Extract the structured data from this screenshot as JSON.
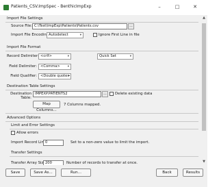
{
  "window": {
    "title": "Patients_CSV.ImpSpec - BenthicImpExp",
    "minimize": "–",
    "maximize": "□",
    "close": "✕"
  },
  "import_file_settings": {
    "title": "Import File Settings",
    "source_label": "Source File:",
    "source_value": "C:\\Test\\ImpExp\\Patients\\Patients.csv",
    "browse_label": "...",
    "encoding_label": "Import File Encoding:",
    "encoding_value": "Autodetect",
    "ignore_first_label": "Ignore First Line in file"
  },
  "import_file_format": {
    "title": "Import File Format",
    "record_label": "Record Delimiter:",
    "record_value": "<crlf>",
    "quick_set_value": "Quick Set",
    "field_label": "Field Delimiter:",
    "field_value": "<Comma>",
    "qualifier_label": "Field Qualifier:",
    "qualifier_value": "<Double quote>"
  },
  "destination_table_settings": {
    "title": "Destination Table Settings",
    "dest_label_1": "Destination",
    "dest_label_2": "Table:",
    "dest_value": "IMPEXP.PATIENTS2",
    "delete_label": "Delete existing data",
    "map_button": "Map Columns...",
    "mapped_text": "7 Columns mapped."
  },
  "advanced_options": {
    "title": "Advanced Options",
    "limit_title": "Limit and Error Settings",
    "allow_errors_label": "Allow errors",
    "record_limit_label": "Import Record Limit:",
    "record_limit_value": "0",
    "limit_note": "Set to a non-zero value to limit the import.",
    "transfer_title": "Transfer Settings",
    "transfer_label": "Transfer Array Size:",
    "transfer_value": "200",
    "transfer_note": "Number of records to transfer at once."
  },
  "footer": {
    "save": "Save",
    "save_as": "Save As...",
    "run": "Run...",
    "back": "Back",
    "results": "Results"
  }
}
